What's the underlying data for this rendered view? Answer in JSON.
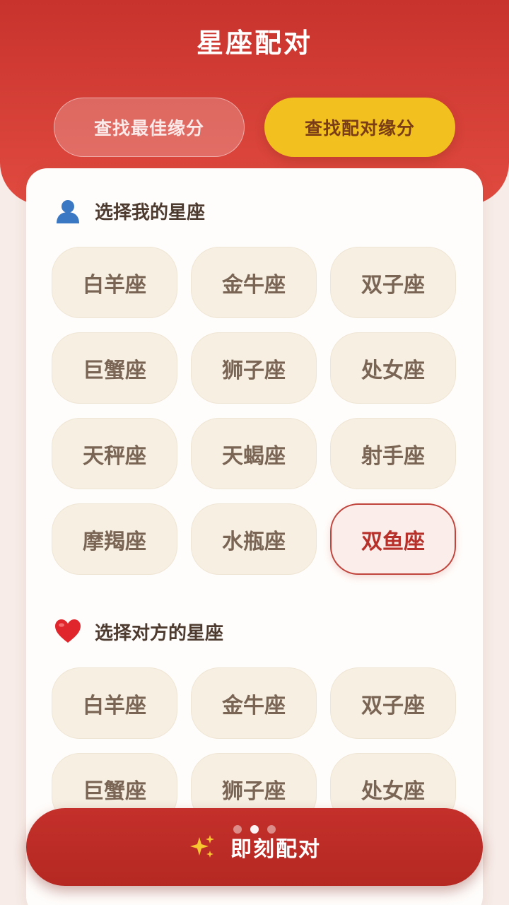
{
  "header": {
    "title": "星座配对"
  },
  "tabs": [
    {
      "label": "查找最佳缘分",
      "active": false
    },
    {
      "label": "查找配对缘分",
      "active": true
    }
  ],
  "my_section": {
    "icon": "person-icon",
    "title": "选择我的星座",
    "signs": [
      "白羊座",
      "金牛座",
      "双子座",
      "巨蟹座",
      "狮子座",
      "处女座",
      "天秤座",
      "天蝎座",
      "射手座",
      "摩羯座",
      "水瓶座",
      "双鱼座"
    ],
    "selected": "双鱼座"
  },
  "partner_section": {
    "icon": "heart-icon",
    "title": "选择对方的星座",
    "signs": [
      "白羊座",
      "金牛座",
      "双子座",
      "巨蟹座",
      "狮子座",
      "处女座"
    ]
  },
  "action": {
    "icon": "sparkles-icon",
    "label": "即刻配对"
  },
  "pager": {
    "count": 3,
    "active_index": 1
  },
  "colors": {
    "header_red": "#c8332d",
    "tab_active_yellow": "#f2c11f",
    "selected_border": "#c0433c",
    "button_red": "#c4302b"
  }
}
